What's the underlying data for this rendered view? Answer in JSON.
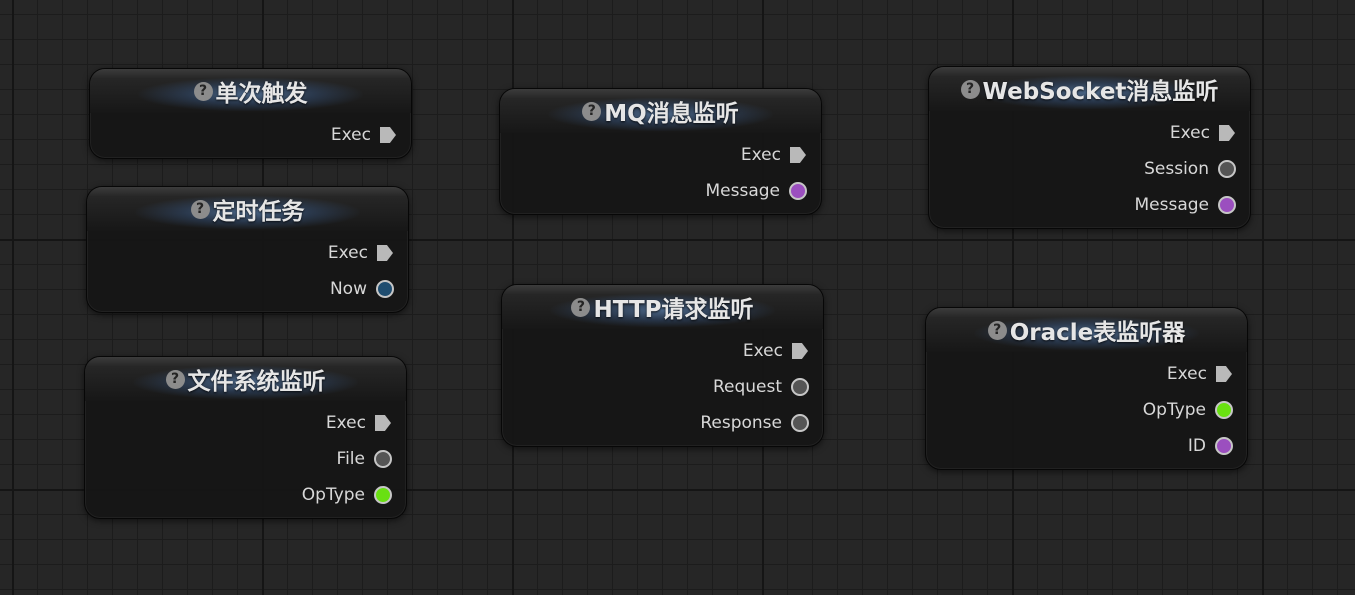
{
  "nodes": [
    {
      "title": "单次触发",
      "help_glyph": "?",
      "pins": [
        {
          "label": "Exec",
          "kind": "exec",
          "color": "#b9b9b9"
        }
      ]
    },
    {
      "title": "定时任务",
      "help_glyph": "?",
      "pins": [
        {
          "label": "Exec",
          "kind": "exec",
          "color": "#b9b9b9"
        },
        {
          "label": "Now",
          "kind": "data",
          "color": "#1f4d70"
        }
      ]
    },
    {
      "title": "文件系统监听",
      "help_glyph": "?",
      "pins": [
        {
          "label": "Exec",
          "kind": "exec",
          "color": "#b9b9b9"
        },
        {
          "label": "File",
          "kind": "data",
          "color": "#555555"
        },
        {
          "label": "OpType",
          "kind": "data",
          "color": "#69e012"
        }
      ]
    },
    {
      "title": "MQ消息监听",
      "help_glyph": "?",
      "pins": [
        {
          "label": "Exec",
          "kind": "exec",
          "color": "#b9b9b9"
        },
        {
          "label": "Message",
          "kind": "data",
          "color": "#9b4fbf"
        }
      ]
    },
    {
      "title": "HTTP请求监听",
      "help_glyph": "?",
      "pins": [
        {
          "label": "Exec",
          "kind": "exec",
          "color": "#b9b9b9"
        },
        {
          "label": "Request",
          "kind": "data",
          "color": "#555555"
        },
        {
          "label": "Response",
          "kind": "data",
          "color": "#555555"
        }
      ]
    },
    {
      "title": "WebSocket消息监听",
      "help_glyph": "?",
      "pins": [
        {
          "label": "Exec",
          "kind": "exec",
          "color": "#b9b9b9"
        },
        {
          "label": "Session",
          "kind": "data",
          "color": "#555555"
        },
        {
          "label": "Message",
          "kind": "data",
          "color": "#9b4fbf"
        }
      ]
    },
    {
      "title": "Oracle表监听器",
      "help_glyph": "?",
      "pins": [
        {
          "label": "Exec",
          "kind": "exec",
          "color": "#b9b9b9"
        },
        {
          "label": "OpType",
          "kind": "data",
          "color": "#69e012"
        },
        {
          "label": "ID",
          "kind": "data",
          "color": "#9b4fbf"
        }
      ]
    }
  ]
}
